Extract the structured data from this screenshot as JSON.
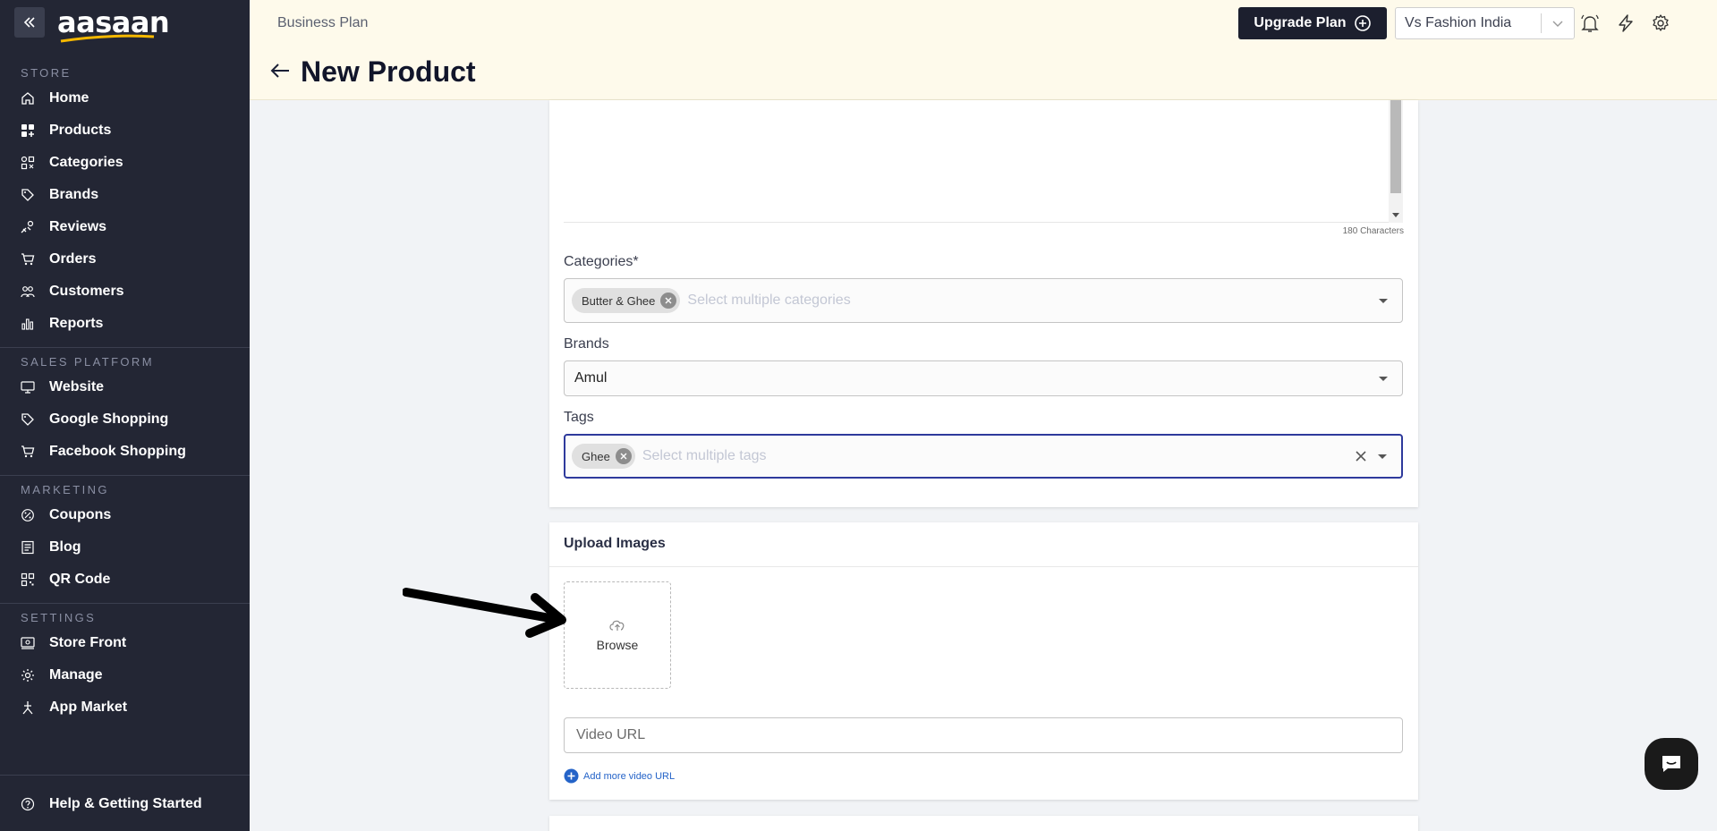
{
  "sidebar": {
    "logo": "aasaan",
    "sections": [
      {
        "title": "STORE",
        "items": [
          {
            "label": "Home",
            "icon": "home-icon"
          },
          {
            "label": "Products",
            "icon": "grid-plus-icon"
          },
          {
            "label": "Categories",
            "icon": "categories-icon"
          },
          {
            "label": "Brands",
            "icon": "tag-icon"
          },
          {
            "label": "Reviews",
            "icon": "reviews-icon"
          },
          {
            "label": "Orders",
            "icon": "cart-icon"
          },
          {
            "label": "Customers",
            "icon": "users-icon"
          },
          {
            "label": "Reports",
            "icon": "bar-chart-icon"
          }
        ]
      },
      {
        "title": "SALES PLATFORM",
        "items": [
          {
            "label": "Website",
            "icon": "monitor-icon"
          },
          {
            "label": "Google Shopping",
            "icon": "tag-icon"
          },
          {
            "label": "Facebook Shopping",
            "icon": "cart-icon"
          }
        ]
      },
      {
        "title": "MARKETING",
        "items": [
          {
            "label": "Coupons",
            "icon": "coupon-icon"
          },
          {
            "label": "Blog",
            "icon": "blog-icon"
          },
          {
            "label": "QR Code",
            "icon": "qr-code-icon"
          }
        ]
      },
      {
        "title": "SETTINGS",
        "items": [
          {
            "label": "Store Front",
            "icon": "store-front-icon"
          },
          {
            "label": "Manage",
            "icon": "gear-icon"
          },
          {
            "label": "App Market",
            "icon": "app-market-icon"
          }
        ]
      }
    ],
    "help": {
      "label": "Help & Getting Started",
      "icon": "help-icon"
    }
  },
  "header": {
    "plan": "Business Plan",
    "title": "New Product",
    "upgrade_label": "Upgrade Plan",
    "store_name": "Vs Fashion India"
  },
  "form": {
    "char_count": "180 Characters",
    "categories": {
      "label": "Categories*",
      "chips": [
        "Butter & Ghee"
      ],
      "placeholder": "Select multiple categories"
    },
    "brands": {
      "label": "Brands",
      "value": "Amul"
    },
    "tags": {
      "label": "Tags",
      "chips": [
        "Ghee"
      ],
      "placeholder": "Select multiple tags"
    }
  },
  "upload": {
    "title": "Upload Images",
    "browse_label": "Browse",
    "video_placeholder": "Video URL",
    "add_video_label": "Add more video URL"
  },
  "colors": {
    "sidebar_bg": "#232634",
    "header_bg": "#fefaeb",
    "accent_blue": "#2e3a9c",
    "link_blue": "#2463c8"
  }
}
